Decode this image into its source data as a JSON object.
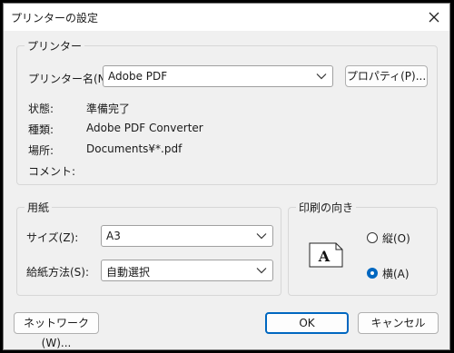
{
  "dialog": {
    "title": "プリンターの設定"
  },
  "printer": {
    "group_label": "プリンター",
    "name_label": "プリンター名(N):",
    "name_value": "Adobe PDF",
    "properties_button": "プロパティ(P)...",
    "status_label": "状態:",
    "status_value": "準備完了",
    "type_label": "種類:",
    "type_value": "Adobe PDF Converter",
    "where_label": "場所:",
    "where_value": "Documents¥*.pdf",
    "comment_label": "コメント:",
    "comment_value": ""
  },
  "paper": {
    "group_label": "用紙",
    "size_label": "サイズ(Z):",
    "size_value": "A3",
    "source_label": "給紙方法(S):",
    "source_value": "自動選択"
  },
  "orientation": {
    "group_label": "印刷の向き",
    "portrait_label": "縦(O)",
    "landscape_label": "横(A)",
    "selected": "landscape",
    "preview_letter": "A"
  },
  "footer": {
    "network_button": "ネットワーク(W)...",
    "ok_button": "OK",
    "cancel_button": "キャンセル"
  },
  "colors": {
    "accent": "#0067c0"
  }
}
